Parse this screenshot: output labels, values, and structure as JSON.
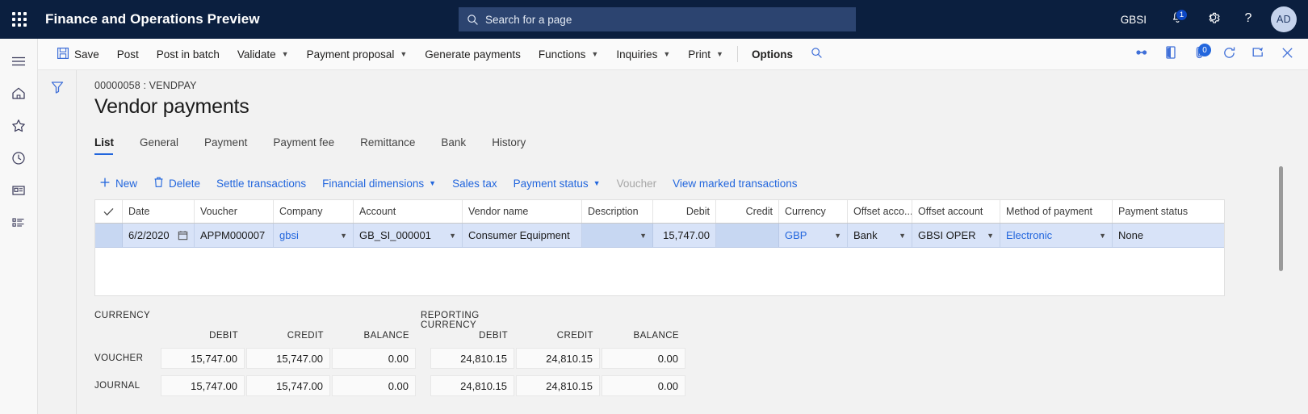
{
  "topbar": {
    "waffle_icon": "waffle-menu-icon",
    "app_title": "Finance and Operations Preview",
    "search": {
      "icon": "search-icon",
      "placeholder": "Search for a page",
      "value": ""
    },
    "company": "GBSI",
    "notifications": {
      "icon": "bell-icon",
      "count": "1"
    },
    "settings_icon": "gear-icon",
    "help_icon": "question-mark-icon",
    "avatar": "AD",
    "bg_color": "#0b1f3f",
    "search_bg_color": "#2c4470"
  },
  "rail": {
    "items": [
      {
        "name": "hamburger-menu-icon",
        "label": "Expand the navigation pane"
      },
      {
        "name": "home-icon",
        "label": "Home"
      },
      {
        "name": "star-icon",
        "label": "Favorites"
      },
      {
        "name": "clock-icon",
        "label": "Recent"
      },
      {
        "name": "workspaces-icon",
        "label": "Workspaces"
      },
      {
        "name": "modules-list-icon",
        "label": "Modules"
      }
    ]
  },
  "command_bar": {
    "items": [
      {
        "label": "Save",
        "icon": "save-floppy-icon",
        "chevron": false,
        "bold": false
      },
      {
        "label": "Post",
        "icon": "",
        "chevron": false,
        "bold": false
      },
      {
        "label": "Post in batch",
        "icon": "",
        "chevron": false,
        "bold": false
      },
      {
        "label": "Validate",
        "icon": "",
        "chevron": true,
        "bold": false
      },
      {
        "label": "Payment proposal",
        "icon": "",
        "chevron": true,
        "bold": false
      },
      {
        "label": "Generate payments",
        "icon": "",
        "chevron": false,
        "bold": false
      },
      {
        "label": "Functions",
        "icon": "",
        "chevron": true,
        "bold": false
      },
      {
        "label": "Inquiries",
        "icon": "",
        "chevron": true,
        "bold": false
      },
      {
        "label": "Print",
        "icon": "",
        "chevron": true,
        "bold": false
      },
      {
        "label": "Options",
        "icon": "",
        "chevron": false,
        "bold": true
      }
    ],
    "filter_search_icon": "search-icon",
    "right_icons": [
      {
        "name": "relationships-icon",
        "badge": ""
      },
      {
        "name": "office-export-icon",
        "badge": ""
      },
      {
        "name": "attachments-icon",
        "badge": "0"
      },
      {
        "name": "refresh-icon",
        "badge": ""
      },
      {
        "name": "open-in-new-window-icon",
        "badge": ""
      },
      {
        "name": "close-icon",
        "badge": ""
      }
    ]
  },
  "page": {
    "filter_icon": "filter-funnel-icon",
    "breadcrumb": "00000058 : VENDPAY",
    "title": "Vendor payments",
    "tabs": [
      {
        "label": "List",
        "active": true
      },
      {
        "label": "General",
        "active": false
      },
      {
        "label": "Payment",
        "active": false
      },
      {
        "label": "Payment fee",
        "active": false
      },
      {
        "label": "Remittance",
        "active": false
      },
      {
        "label": "Bank",
        "active": false
      },
      {
        "label": "History",
        "active": false
      }
    ]
  },
  "grid_toolbar": {
    "items": [
      {
        "label": "New",
        "icon": "plus-icon",
        "chevron": false,
        "disabled": false
      },
      {
        "label": "Delete",
        "icon": "trash-icon",
        "chevron": false,
        "disabled": false
      },
      {
        "label": "Settle transactions",
        "icon": "",
        "chevron": false,
        "disabled": false
      },
      {
        "label": "Financial dimensions",
        "icon": "",
        "chevron": true,
        "disabled": false
      },
      {
        "label": "Sales tax",
        "icon": "",
        "chevron": false,
        "disabled": false
      },
      {
        "label": "Payment status",
        "icon": "",
        "chevron": true,
        "disabled": false
      },
      {
        "label": "Voucher",
        "icon": "",
        "chevron": false,
        "disabled": true
      },
      {
        "label": "View marked transactions",
        "icon": "",
        "chevron": false,
        "disabled": false
      }
    ]
  },
  "grid": {
    "select_all_icon": "checkmark-icon",
    "columns": [
      {
        "label": "Date",
        "align": "left"
      },
      {
        "label": "Voucher",
        "align": "left"
      },
      {
        "label": "Company",
        "align": "left"
      },
      {
        "label": "Account",
        "align": "left"
      },
      {
        "label": "Vendor name",
        "align": "left"
      },
      {
        "label": "Description",
        "align": "left"
      },
      {
        "label": "Debit",
        "align": "right"
      },
      {
        "label": "Credit",
        "align": "right"
      },
      {
        "label": "Currency",
        "align": "left"
      },
      {
        "label": "Offset acco...",
        "align": "left"
      },
      {
        "label": "Offset account",
        "align": "left"
      },
      {
        "label": "Method of payment",
        "align": "left"
      },
      {
        "label": "Payment status",
        "align": "left"
      }
    ],
    "row": {
      "date": "6/2/2020",
      "date_icon": "calendar-icon",
      "voucher": "APPM000007",
      "company": "gbsi",
      "account": "GB_SI_000001",
      "vendor_name": "Consumer Equipment",
      "description": "",
      "debit": "15,747.00",
      "credit": "",
      "currency": "GBP",
      "offset_account_type": "Bank",
      "offset_account": "GBSI OPER",
      "method_of_payment": "Electronic",
      "payment_status": "None"
    },
    "row_selected_color": "#d8e3f8",
    "scrollbar": {
      "name": "grid-vertical-scrollbar"
    }
  },
  "totals": {
    "group_currency": "CURRENCY",
    "group_reporting": "REPORTING CURRENCY",
    "col_headers": [
      "DEBIT",
      "CREDIT",
      "BALANCE"
    ],
    "rows": [
      {
        "label": "VOUCHER",
        "currency": [
          "15,747.00",
          "15,747.00",
          "0.00"
        ],
        "reporting": [
          "24,810.15",
          "24,810.15",
          "0.00"
        ]
      },
      {
        "label": "JOURNAL",
        "currency": [
          "15,747.00",
          "15,747.00",
          "0.00"
        ],
        "reporting": [
          "24,810.15",
          "24,810.15",
          "0.00"
        ]
      }
    ]
  }
}
